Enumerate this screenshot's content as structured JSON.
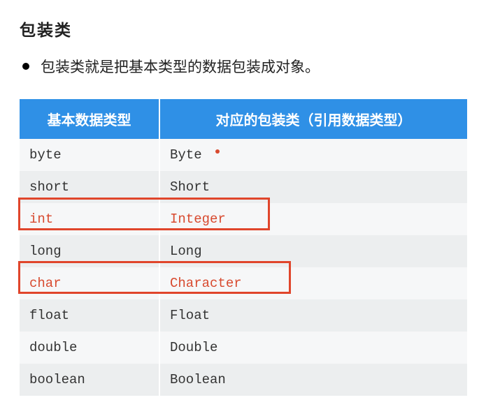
{
  "heading": "包装类",
  "bullet": "包装类就是把基本类型的数据包装成对象。",
  "headers": {
    "primitive": "基本数据类型",
    "wrapper": "对应的包装类（引用数据类型）"
  },
  "rows": [
    {
      "primitive": "byte",
      "wrapper": "Byte",
      "highlighted": false
    },
    {
      "primitive": "short",
      "wrapper": "Short",
      "highlighted": false
    },
    {
      "primitive": "int",
      "wrapper": "Integer",
      "highlighted": true
    },
    {
      "primitive": "long",
      "wrapper": "Long",
      "highlighted": false
    },
    {
      "primitive": "char",
      "wrapper": "Character",
      "highlighted": true
    },
    {
      "primitive": "float",
      "wrapper": "Float",
      "highlighted": false
    },
    {
      "primitive": "double",
      "wrapper": "Double",
      "highlighted": false
    },
    {
      "primitive": "boolean",
      "wrapper": "Boolean",
      "highlighted": false
    }
  ],
  "chart_data": {
    "type": "table",
    "title": "包装类",
    "columns": [
      "基本数据类型",
      "对应的包装类（引用数据类型）"
    ],
    "rows": [
      [
        "byte",
        "Byte"
      ],
      [
        "short",
        "Short"
      ],
      [
        "int",
        "Integer"
      ],
      [
        "long",
        "Long"
      ],
      [
        "char",
        "Character"
      ],
      [
        "float",
        "Float"
      ],
      [
        "double",
        "Double"
      ],
      [
        "boolean",
        "Boolean"
      ]
    ],
    "highlighted_rows": [
      2,
      4
    ]
  }
}
